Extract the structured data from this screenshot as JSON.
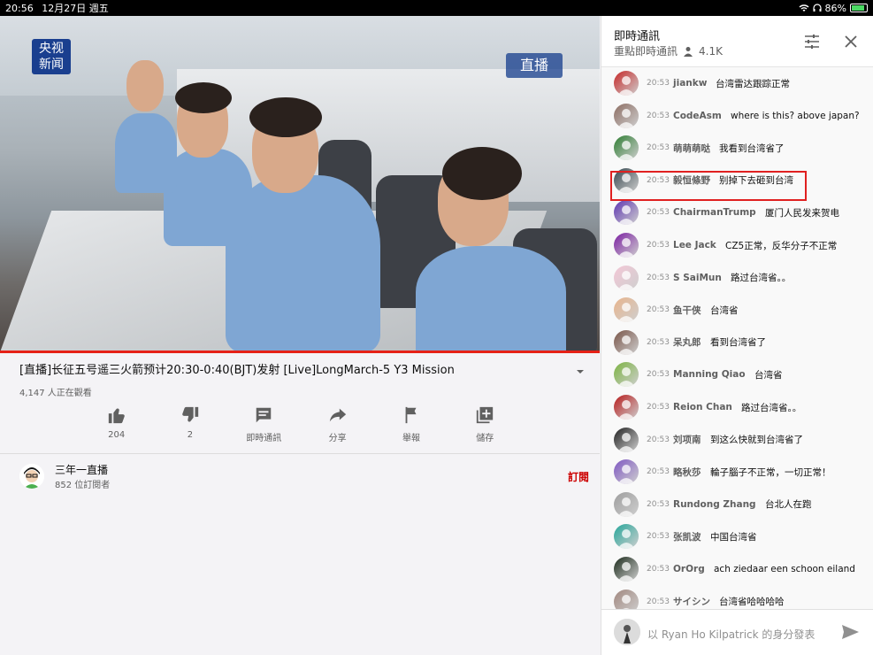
{
  "status_bar": {
    "time": "20:56",
    "date": "12月27日 週五",
    "battery": "86%",
    "battery_level": 0.86
  },
  "video": {
    "channel_logo_line1": "央视",
    "channel_logo_line2": "新闻",
    "live_badge": "直播"
  },
  "video_info": {
    "title": "[直播]长征五号遥三火箭预计20:30-0:40(BJT)发射 [Live]LongMarch-5 Y3 Mission",
    "viewers": "4,147 人正在觀看",
    "actions": [
      {
        "icon": "thumb-up-icon",
        "label": "204"
      },
      {
        "icon": "thumb-down-icon",
        "label": "2"
      },
      {
        "icon": "chat-icon",
        "label": "即時通訊"
      },
      {
        "icon": "share-icon",
        "label": "分享"
      },
      {
        "icon": "flag-icon",
        "label": "舉報"
      },
      {
        "icon": "save-icon",
        "label": "儲存"
      }
    ]
  },
  "channel": {
    "name": "三年一直播",
    "subscribers": "852 位訂閱者",
    "subscribe_label": "訂閱"
  },
  "chat": {
    "title": "即時通訊",
    "mode": "重點即時通訊",
    "viewer_count": "4.1K",
    "input_placeholder": "以 Ryan Ho Kilpatrick 的身分發表",
    "messages": [
      {
        "time": "20:53",
        "author": "jiankw",
        "text": "台湾雷达跟踪正常",
        "color": "#c62828"
      },
      {
        "time": "20:53",
        "author": "CodeAsm",
        "text": "where is this? above japan?",
        "color": "#8d6e63"
      },
      {
        "time": "20:53",
        "author": "萌萌萌哒",
        "text": "我看到台湾省了",
        "color": "#2e7d32"
      },
      {
        "time": "20:53",
        "author": "毅恒條野",
        "text": "别掉下去砸到台湾",
        "color": "#37474f"
      },
      {
        "time": "20:53",
        "author": "ChairmanTrump",
        "text": "厦门人民发来贺电",
        "color": "#5e35b1"
      },
      {
        "time": "20:53",
        "author": "Lee Jack",
        "text": "CZ5正常，反华分子不正常",
        "color": "#7b1fa2"
      },
      {
        "time": "20:53",
        "author": "S SaiMun",
        "text": "路过台湾省。。",
        "color": "#f3c7d6"
      },
      {
        "time": "20:53",
        "author": "鱼干侠",
        "text": "台湾省",
        "color": "#e8b48c"
      },
      {
        "time": "20:53",
        "author": "呆丸郎",
        "text": "看到台湾省了",
        "color": "#795548"
      },
      {
        "time": "20:53",
        "author": "Manning Qiao",
        "text": "台湾省",
        "color": "#7cb342"
      },
      {
        "time": "20:53",
        "author": "Reion Chan",
        "text": "路过台湾省。。",
        "color": "#b71c1c"
      },
      {
        "time": "20:53",
        "author": "刘项南",
        "text": "到这么快就到台湾省了",
        "color": "#212121"
      },
      {
        "time": "20:53",
        "author": "略秋莎",
        "text": "輪子腦子不正常，一切正常！",
        "color": "#7e57c2"
      },
      {
        "time": "20:53",
        "author": "Rundong Zhang",
        "text": "台北人在跑",
        "color": "#9e9e9e"
      },
      {
        "time": "20:53",
        "author": "张凯波",
        "text": "中国台湾省",
        "color": "#26a69a"
      },
      {
        "time": "20:53",
        "author": "OrOrg",
        "text": "ach ziedaar een schoon eiland",
        "color": "#1b2a1b"
      },
      {
        "time": "20:53",
        "author": "サイシン",
        "text": "台湾省哈哈哈哈",
        "color": "#a1887f"
      }
    ]
  }
}
